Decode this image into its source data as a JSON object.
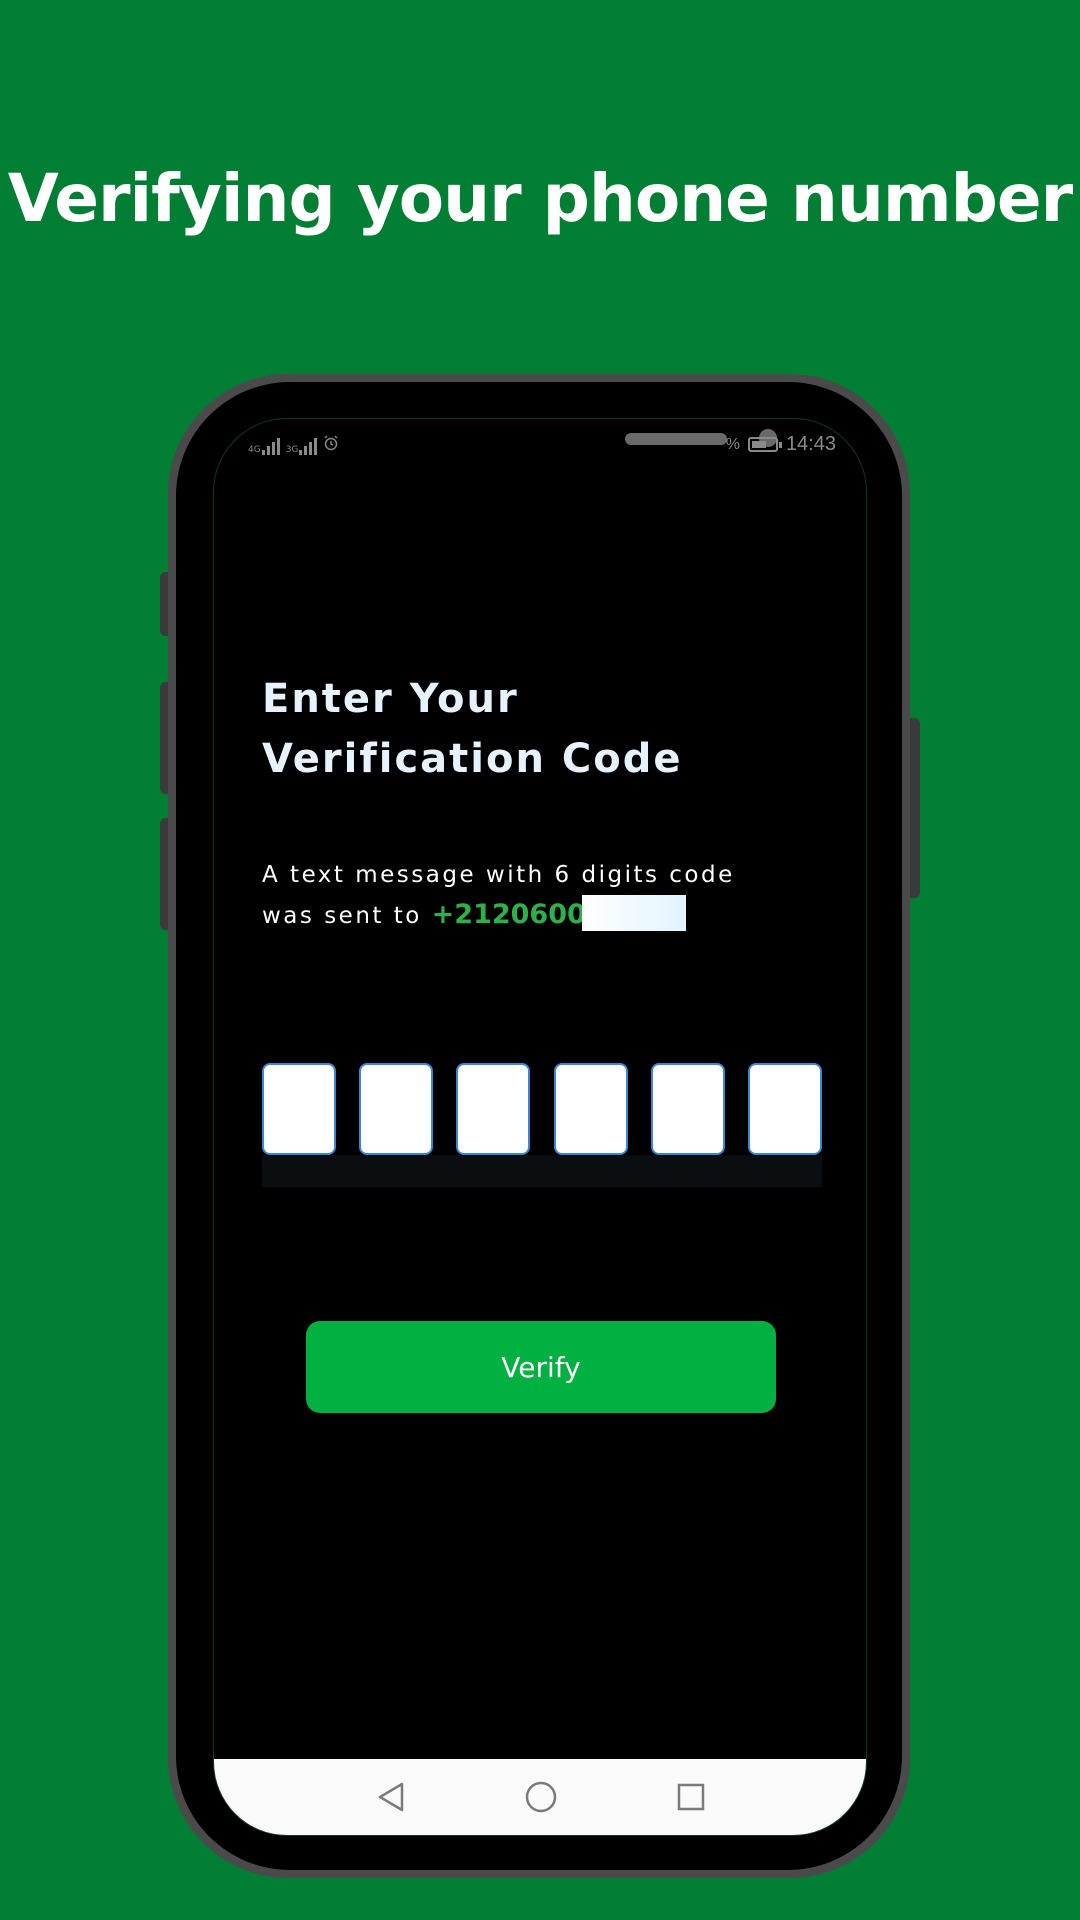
{
  "headline": "Verifying your phone number",
  "status_bar": {
    "network_1": "4G",
    "network_2": "3G",
    "battery_percent": "%",
    "time": "14:43",
    "alarm_icon": "alarm-icon",
    "battery_icon": "battery-charging-icon"
  },
  "screen": {
    "title_line1": "Enter Your",
    "title_line2": "Verification Code",
    "subtitle_line1": "A text message with 6 digits code",
    "subtitle_line2_prefix": "was sent to",
    "phone_number": "+2120600",
    "otp_digits": [
      "",
      "",
      "",
      "",
      "",
      ""
    ],
    "verify_label": "Verify"
  },
  "nav_bar": {
    "back_icon": "back-triangle-icon",
    "home_icon": "home-circle-icon",
    "recents_icon": "recents-square-icon"
  },
  "colors": {
    "background": "#007e33",
    "accent_green": "#00b040",
    "phone_number_green": "#2bb34a",
    "otp_border": "#3a86d8",
    "title_text": "#e6f3ff"
  }
}
